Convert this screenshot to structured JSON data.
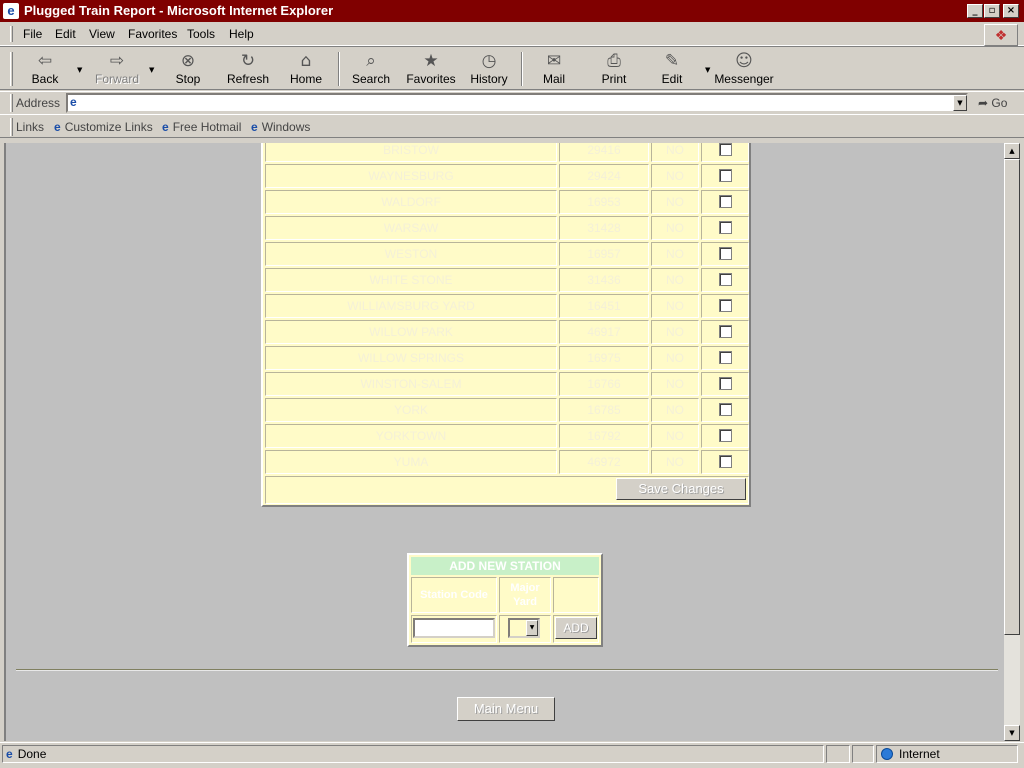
{
  "window": {
    "title": "Plugged Train Report - Microsoft Internet Explorer",
    "controls": {
      "minimize": "_",
      "maximize": "▫",
      "close": "×"
    }
  },
  "menu": [
    "File",
    "Edit",
    "View",
    "Favorites",
    "Tools",
    "Help"
  ],
  "toolbar": {
    "back": "Back",
    "forward": "Forward",
    "stop": "Stop",
    "refresh": "Refresh",
    "home": "Home",
    "search": "Search",
    "favorites": "Favorites",
    "history": "History",
    "mail": "Mail",
    "print": "Print",
    "edit": "Edit",
    "messenger": "Messenger"
  },
  "address": {
    "label": "Address",
    "value": "",
    "go": "Go"
  },
  "links": {
    "label": "Links",
    "items": [
      "Customize Links",
      "Free Hotmail",
      "Windows"
    ]
  },
  "stations": [
    {
      "name": "BRISTOW",
      "code": "29416",
      "major": "NO",
      "delete": false
    },
    {
      "name": "WAYNESBURG",
      "code": "29424",
      "major": "NO",
      "delete": false
    },
    {
      "name": "WALDORF",
      "code": "16953",
      "major": "NO",
      "delete": false
    },
    {
      "name": "WARSAW",
      "code": "31428",
      "major": "NO",
      "delete": false
    },
    {
      "name": "WESTON",
      "code": "16957",
      "major": "NO",
      "delete": false
    },
    {
      "name": "WHITE STONE",
      "code": "31436",
      "major": "NO",
      "delete": false
    },
    {
      "name": "WILLIAMSBURG YARD",
      "code": "16451",
      "major": "NO",
      "delete": false
    },
    {
      "name": "WILLOW PARK",
      "code": "46917",
      "major": "NO",
      "delete": false
    },
    {
      "name": "WILLOW SPRINGS",
      "code": "16975",
      "major": "NO",
      "delete": false
    },
    {
      "name": "WINSTON-SALEM",
      "code": "16766",
      "major": "NO",
      "delete": false
    },
    {
      "name": "YORK",
      "code": "16785",
      "major": "NO",
      "delete": false
    },
    {
      "name": "YORKTOWN",
      "code": "16792",
      "major": "NO",
      "delete": false
    },
    {
      "name": "YUMA",
      "code": "46972",
      "major": "NO",
      "delete": false
    }
  ],
  "save_label": "Save Changes",
  "add_station": {
    "header": "ADD NEW STATION",
    "col_code": "Station Code",
    "col_major": "Major Yard",
    "code_value": "",
    "major_value": "",
    "add_label": "ADD"
  },
  "main_menu_label": "Main Menu",
  "status": {
    "text": "Done",
    "zone": "Internet"
  },
  "colors": {
    "title_bar": "#800000",
    "table_bg": "#fffbc8",
    "header_green": "#c8f0c8",
    "chrome": "#d4d0c8"
  }
}
